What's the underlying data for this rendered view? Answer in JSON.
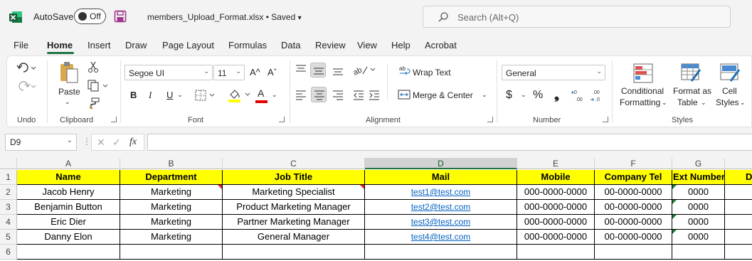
{
  "titlebar": {
    "autosave_label": "AutoSave",
    "toggle_text": "Off",
    "filename": "members_Upload_Format.xlsx • Saved",
    "filename_caret": "▾",
    "search_placeholder": "Search (Alt+Q)"
  },
  "menu": [
    "File",
    "Home",
    "Insert",
    "Draw",
    "Page Layout",
    "Formulas",
    "Data",
    "Review",
    "View",
    "Help",
    "Acrobat"
  ],
  "ribbon": {
    "groups": [
      "Undo",
      "Clipboard",
      "Font",
      "Alignment",
      "Number",
      "Styles"
    ],
    "paste": "Paste",
    "font_name": "Segoe UI",
    "font_size": "11",
    "bold": "B",
    "italic": "I",
    "underline": "U",
    "wrap_text": "Wrap Text",
    "merge_center": "Merge & Center",
    "number_format": "General",
    "currency": "$",
    "percent": "%",
    "comma": "❟",
    "conditional": [
      "Conditional",
      "Formatting"
    ],
    "format_table": [
      "Format as",
      "Table"
    ],
    "cell_styles": [
      "Cell",
      "Styles"
    ],
    "grow_font": "A^",
    "shrink_font": "Aˇ",
    "font_color_letter": "A"
  },
  "formula": {
    "namebox": "D9",
    "fx": "fx",
    "value": ""
  },
  "columns": [
    "A",
    "B",
    "C",
    "D",
    "E",
    "F",
    "G",
    "D"
  ],
  "rows": [
    "1",
    "2",
    "3",
    "4",
    "5",
    "6"
  ],
  "headers": [
    "Name",
    "Department",
    "Job Title",
    "Mail",
    "Mobile",
    "Company Tel",
    "Ext Number",
    "D"
  ],
  "data": [
    [
      "Jacob Henry",
      "Marketing",
      "Marketing Specialist",
      "test1@test.com",
      "000-0000-0000",
      "00-0000-0000",
      "0000"
    ],
    [
      "Benjamin Button",
      "Marketing",
      "Product Marketing Manager",
      "test2@test.com",
      "000-0000-0000",
      "00-0000-0000",
      "0000"
    ],
    [
      "Eric Dier",
      "Marketing",
      "Partner Marketing Manager",
      "test3@test.com",
      "000-0000-0000",
      "00-0000-0000",
      "0000"
    ],
    [
      "Danny Elon",
      "Marketing",
      "General Manager",
      "test4@test.com",
      "000-0000-0000",
      "00-0000-0000",
      "0000"
    ]
  ],
  "colors": {
    "excel_green": "#217346",
    "header_fill": "#ffff00",
    "link": "#0563c1"
  }
}
